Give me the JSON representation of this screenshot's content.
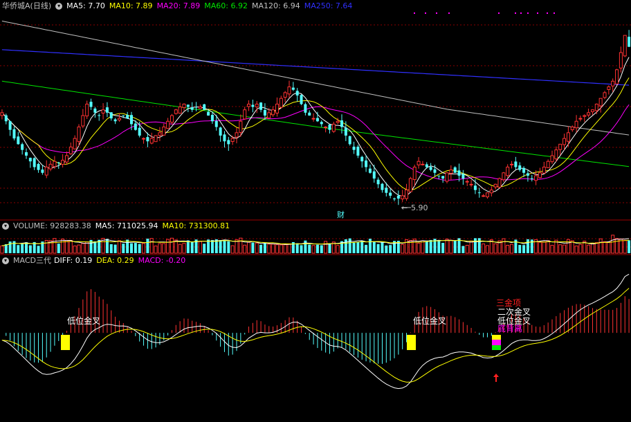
{
  "panel_main": {
    "stock_name": "华侨城A",
    "period": "(日线)",
    "ma5_label": "MA5: 7.70",
    "ma10_label": "MA10: 7.89",
    "ma20_label": "MA20: 7.89",
    "ma60_label": "MA60: 6.92",
    "ma120_label": "MA120: 6.94",
    "ma250_label": "MA250: 7.64",
    "low_marker": "5.90",
    "finance_marker": "财"
  },
  "panel_volume": {
    "volume_label": "VOLUME: 928283.38",
    "ma5_label": "MA5: 711025.94",
    "ma10_label": "MA10: 731300.81"
  },
  "panel_macd": {
    "title": "MACD三代",
    "diff_label": "DIFF: 0.19",
    "dea_label": "DEA: 0.29",
    "macd_label": "MACD: -0.20",
    "annotations": [
      "低位金叉",
      "低位金叉",
      "三金项",
      "二次金叉",
      "低位金叉",
      "底背离"
    ]
  },
  "colors": {
    "up": "#ff3232",
    "down": "#54ffff",
    "ma5": "#ffffff",
    "ma10": "#ffff00",
    "ma20": "#ff00ff",
    "ma60": "#00e600",
    "ma120": "#c0c0c0",
    "ma250": "#3030ff",
    "grid": "#8b0000",
    "signal_yellow": "#ffff00",
    "signal_magenta": "#ff00ff",
    "signal_green": "#00e600",
    "annot_red": "#ff2020",
    "annot_white": "#ffffff"
  },
  "chart_data": {
    "type": "candlestick",
    "count": 160,
    "price_range": [
      5.6,
      9.2
    ],
    "closes": [
      7.45,
      7.3,
      7.15,
      7.0,
      6.9,
      6.8,
      6.7,
      6.6,
      6.5,
      6.45,
      6.4,
      6.5,
      6.55,
      6.6,
      6.58,
      6.62,
      6.7,
      6.85,
      7.0,
      7.2,
      7.4,
      7.6,
      7.55,
      7.45,
      7.4,
      7.5,
      7.45,
      7.35,
      7.3,
      7.35,
      7.4,
      7.35,
      7.25,
      7.15,
      7.05,
      7.0,
      6.95,
      7.0,
      7.05,
      7.1,
      7.2,
      7.3,
      7.4,
      7.5,
      7.55,
      7.6,
      7.55,
      7.5,
      7.55,
      7.55,
      7.5,
      7.4,
      7.3,
      7.2,
      7.05,
      6.95,
      6.9,
      7.0,
      7.1,
      7.3,
      7.5,
      7.6,
      7.55,
      7.6,
      7.5,
      7.4,
      7.45,
      7.5,
      7.6,
      7.7,
      7.8,
      7.9,
      7.85,
      7.75,
      7.6,
      7.45,
      7.4,
      7.35,
      7.3,
      7.25,
      7.2,
      7.15,
      7.25,
      7.3,
      7.2,
      7.05,
      6.9,
      6.8,
      6.7,
      6.6,
      6.5,
      6.4,
      6.3,
      6.2,
      6.1,
      6.05,
      6.0,
      5.95,
      5.95,
      6.0,
      6.1,
      6.3,
      6.5,
      6.6,
      6.55,
      6.5,
      6.45,
      6.4,
      6.35,
      6.3,
      6.4,
      6.45,
      6.4,
      6.35,
      6.3,
      6.25,
      6.2,
      6.1,
      6.05,
      6.0,
      6.05,
      6.1,
      6.2,
      6.3,
      6.4,
      6.5,
      6.55,
      6.5,
      6.45,
      6.4,
      6.35,
      6.3,
      6.35,
      6.4,
      6.5,
      6.6,
      6.7,
      6.8,
      6.9,
      7.0,
      7.1,
      7.2,
      7.3,
      7.35,
      7.4,
      7.45,
      7.5,
      7.6,
      7.7,
      7.8,
      7.9,
      8.0,
      8.2,
      8.5,
      8.8,
      8.6
    ],
    "ylim_volume": [
      0,
      1300000
    ],
    "macd_range": [
      -0.6,
      0.45
    ]
  }
}
